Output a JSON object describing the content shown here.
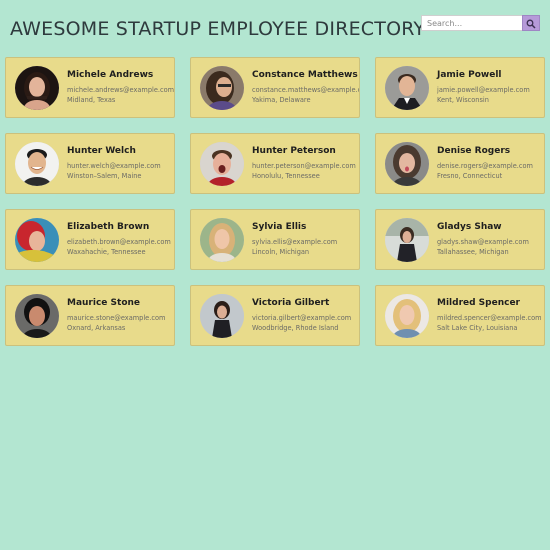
{
  "header": {
    "title": "AWESOME STARTUP EMPLOYEE DIRECTORY"
  },
  "search": {
    "placeholder": "Search...",
    "button_icon": "search-icon"
  },
  "colors": {
    "background": "#b3e6d1",
    "card": "#e8db8b",
    "search_button": "#b69ad9"
  },
  "employees": [
    {
      "name": "Michele Andrews",
      "email": "michele.andrews@example.com",
      "location": "Midland, Texas"
    },
    {
      "name": "Constance Matthews",
      "email": "constance.matthews@example.com",
      "location": "Yakima, Delaware"
    },
    {
      "name": "Jamie Powell",
      "email": "jamie.powell@example.com",
      "location": "Kent, Wisconsin"
    },
    {
      "name": "Hunter Welch",
      "email": "hunter.welch@example.com",
      "location": "Winston–Salem, Maine"
    },
    {
      "name": "Hunter Peterson",
      "email": "hunter.peterson@example.com",
      "location": "Honolulu, Tennessee"
    },
    {
      "name": "Denise Rogers",
      "email": "denise.rogers@example.com",
      "location": "Fresno, Connecticut"
    },
    {
      "name": "Elizabeth Brown",
      "email": "elizabeth.brown@example.com",
      "location": "Waxahachie, Tennessee"
    },
    {
      "name": "Sylvia Ellis",
      "email": "sylvia.ellis@example.com",
      "location": "Lincoln, Michigan"
    },
    {
      "name": "Gladys Shaw",
      "email": "gladys.shaw@example.com",
      "location": "Tallahassee, Michigan"
    },
    {
      "name": "Maurice Stone",
      "email": "maurice.stone@example.com",
      "location": "Oxnard, Arkansas"
    },
    {
      "name": "Victoria Gilbert",
      "email": "victoria.gilbert@example.com",
      "location": "Woodbridge, Rhode Island"
    },
    {
      "name": "Mildred Spencer",
      "email": "mildred.spencer@example.com",
      "location": "Salt Lake City, Louisiana"
    }
  ]
}
